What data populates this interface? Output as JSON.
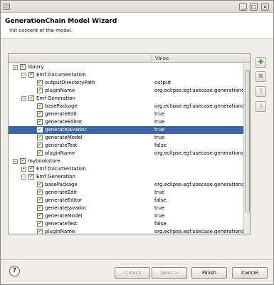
{
  "window": {
    "title": "",
    "controls": {
      "minimize": "_",
      "maximize": "□",
      "close": "×"
    }
  },
  "header": {
    "title": "GenerationChain Model Wizard",
    "description": "Init content of the model."
  },
  "tree": {
    "columns": {
      "name": "",
      "value": "Value"
    },
    "rows": [
      {
        "label": "library",
        "value": "",
        "level": 0,
        "expander": "−",
        "checked": true,
        "selected": false
      },
      {
        "label": "Emf Documentation",
        "value": "",
        "level": 1,
        "expander": "−",
        "checked": true,
        "selected": false
      },
      {
        "label": "outputDirectoryPath",
        "value": "output",
        "level": 2,
        "expander": "",
        "checked": true,
        "selected": false
      },
      {
        "label": "pluginName",
        "value": "org.eclipse.egf.usecase.generationc...",
        "level": 2,
        "expander": "",
        "checked": true,
        "selected": false
      },
      {
        "label": "Emf Generation",
        "value": "",
        "level": 1,
        "expander": "−",
        "checked": true,
        "selected": false
      },
      {
        "label": "basePackage",
        "value": "org.eclipse.egf.usecase.generationc...",
        "level": 2,
        "expander": "",
        "checked": true,
        "selected": false
      },
      {
        "label": "generateEdit",
        "value": "true",
        "level": 2,
        "expander": "",
        "checked": true,
        "selected": false
      },
      {
        "label": "generateEditor",
        "value": "true",
        "level": 2,
        "expander": "",
        "checked": true,
        "selected": false
      },
      {
        "label": "generateJavadoc",
        "value": "true",
        "level": 2,
        "expander": "",
        "checked": true,
        "selected": true
      },
      {
        "label": "generateModel",
        "value": "true",
        "level": 2,
        "expander": "",
        "checked": true,
        "selected": false
      },
      {
        "label": "generateTest",
        "value": "false",
        "level": 2,
        "expander": "",
        "checked": true,
        "selected": false
      },
      {
        "label": "pluginName",
        "value": "org.eclipse.egf.usecase.generationc...",
        "level": 2,
        "expander": "",
        "checked": true,
        "selected": false
      },
      {
        "label": "mybookstore",
        "value": "",
        "level": 0,
        "expander": "−",
        "checked": true,
        "selected": false
      },
      {
        "label": "Emf Documentation",
        "value": "",
        "level": 1,
        "expander": "+",
        "checked": true,
        "selected": false
      },
      {
        "label": "Emf Generation",
        "value": "",
        "level": 1,
        "expander": "−",
        "checked": true,
        "selected": false
      },
      {
        "label": "basePackage",
        "value": "org.eclipse.egf.usecase.generationc...",
        "level": 2,
        "expander": "",
        "checked": true,
        "selected": false
      },
      {
        "label": "generateEdit",
        "value": "true",
        "level": 2,
        "expander": "",
        "checked": true,
        "selected": false
      },
      {
        "label": "generateEditor",
        "value": "false",
        "level": 2,
        "expander": "",
        "checked": true,
        "selected": false
      },
      {
        "label": "generateJavadoc",
        "value": "true",
        "level": 2,
        "expander": "",
        "checked": true,
        "selected": false
      },
      {
        "label": "generateModel",
        "value": "true",
        "level": 2,
        "expander": "",
        "checked": true,
        "selected": false
      },
      {
        "label": "generateTest",
        "value": "false",
        "level": 2,
        "expander": "",
        "checked": true,
        "selected": false
      },
      {
        "label": "pluginName",
        "value": "org.eclipse.egf.usecase.generationc...",
        "level": 2,
        "expander": "",
        "checked": true,
        "selected": false
      }
    ]
  },
  "side_buttons": [
    {
      "name": "add-button",
      "icon": "plus-icon",
      "glyph": "✚",
      "color": "#3a9a2a",
      "enabled": true
    },
    {
      "name": "remove-button",
      "icon": "remove-icon",
      "glyph": "✖",
      "color": "#9a9a9a",
      "enabled": false
    },
    {
      "name": "move-up-button",
      "icon": "arrow-up-icon",
      "glyph": "⇧",
      "color": "#a0a0a0",
      "enabled": false
    },
    {
      "name": "move-down-button",
      "icon": "arrow-down-icon",
      "glyph": "⇩",
      "color": "#a0a0a0",
      "enabled": false
    }
  ],
  "footer": {
    "help_glyph": "?",
    "back_label": "< Back",
    "next_label": "Next >",
    "finish_label": "Finish",
    "cancel_label": "Cancel"
  },
  "colors": {
    "selection": "#3d66a6",
    "check": "#2e7d1e"
  }
}
